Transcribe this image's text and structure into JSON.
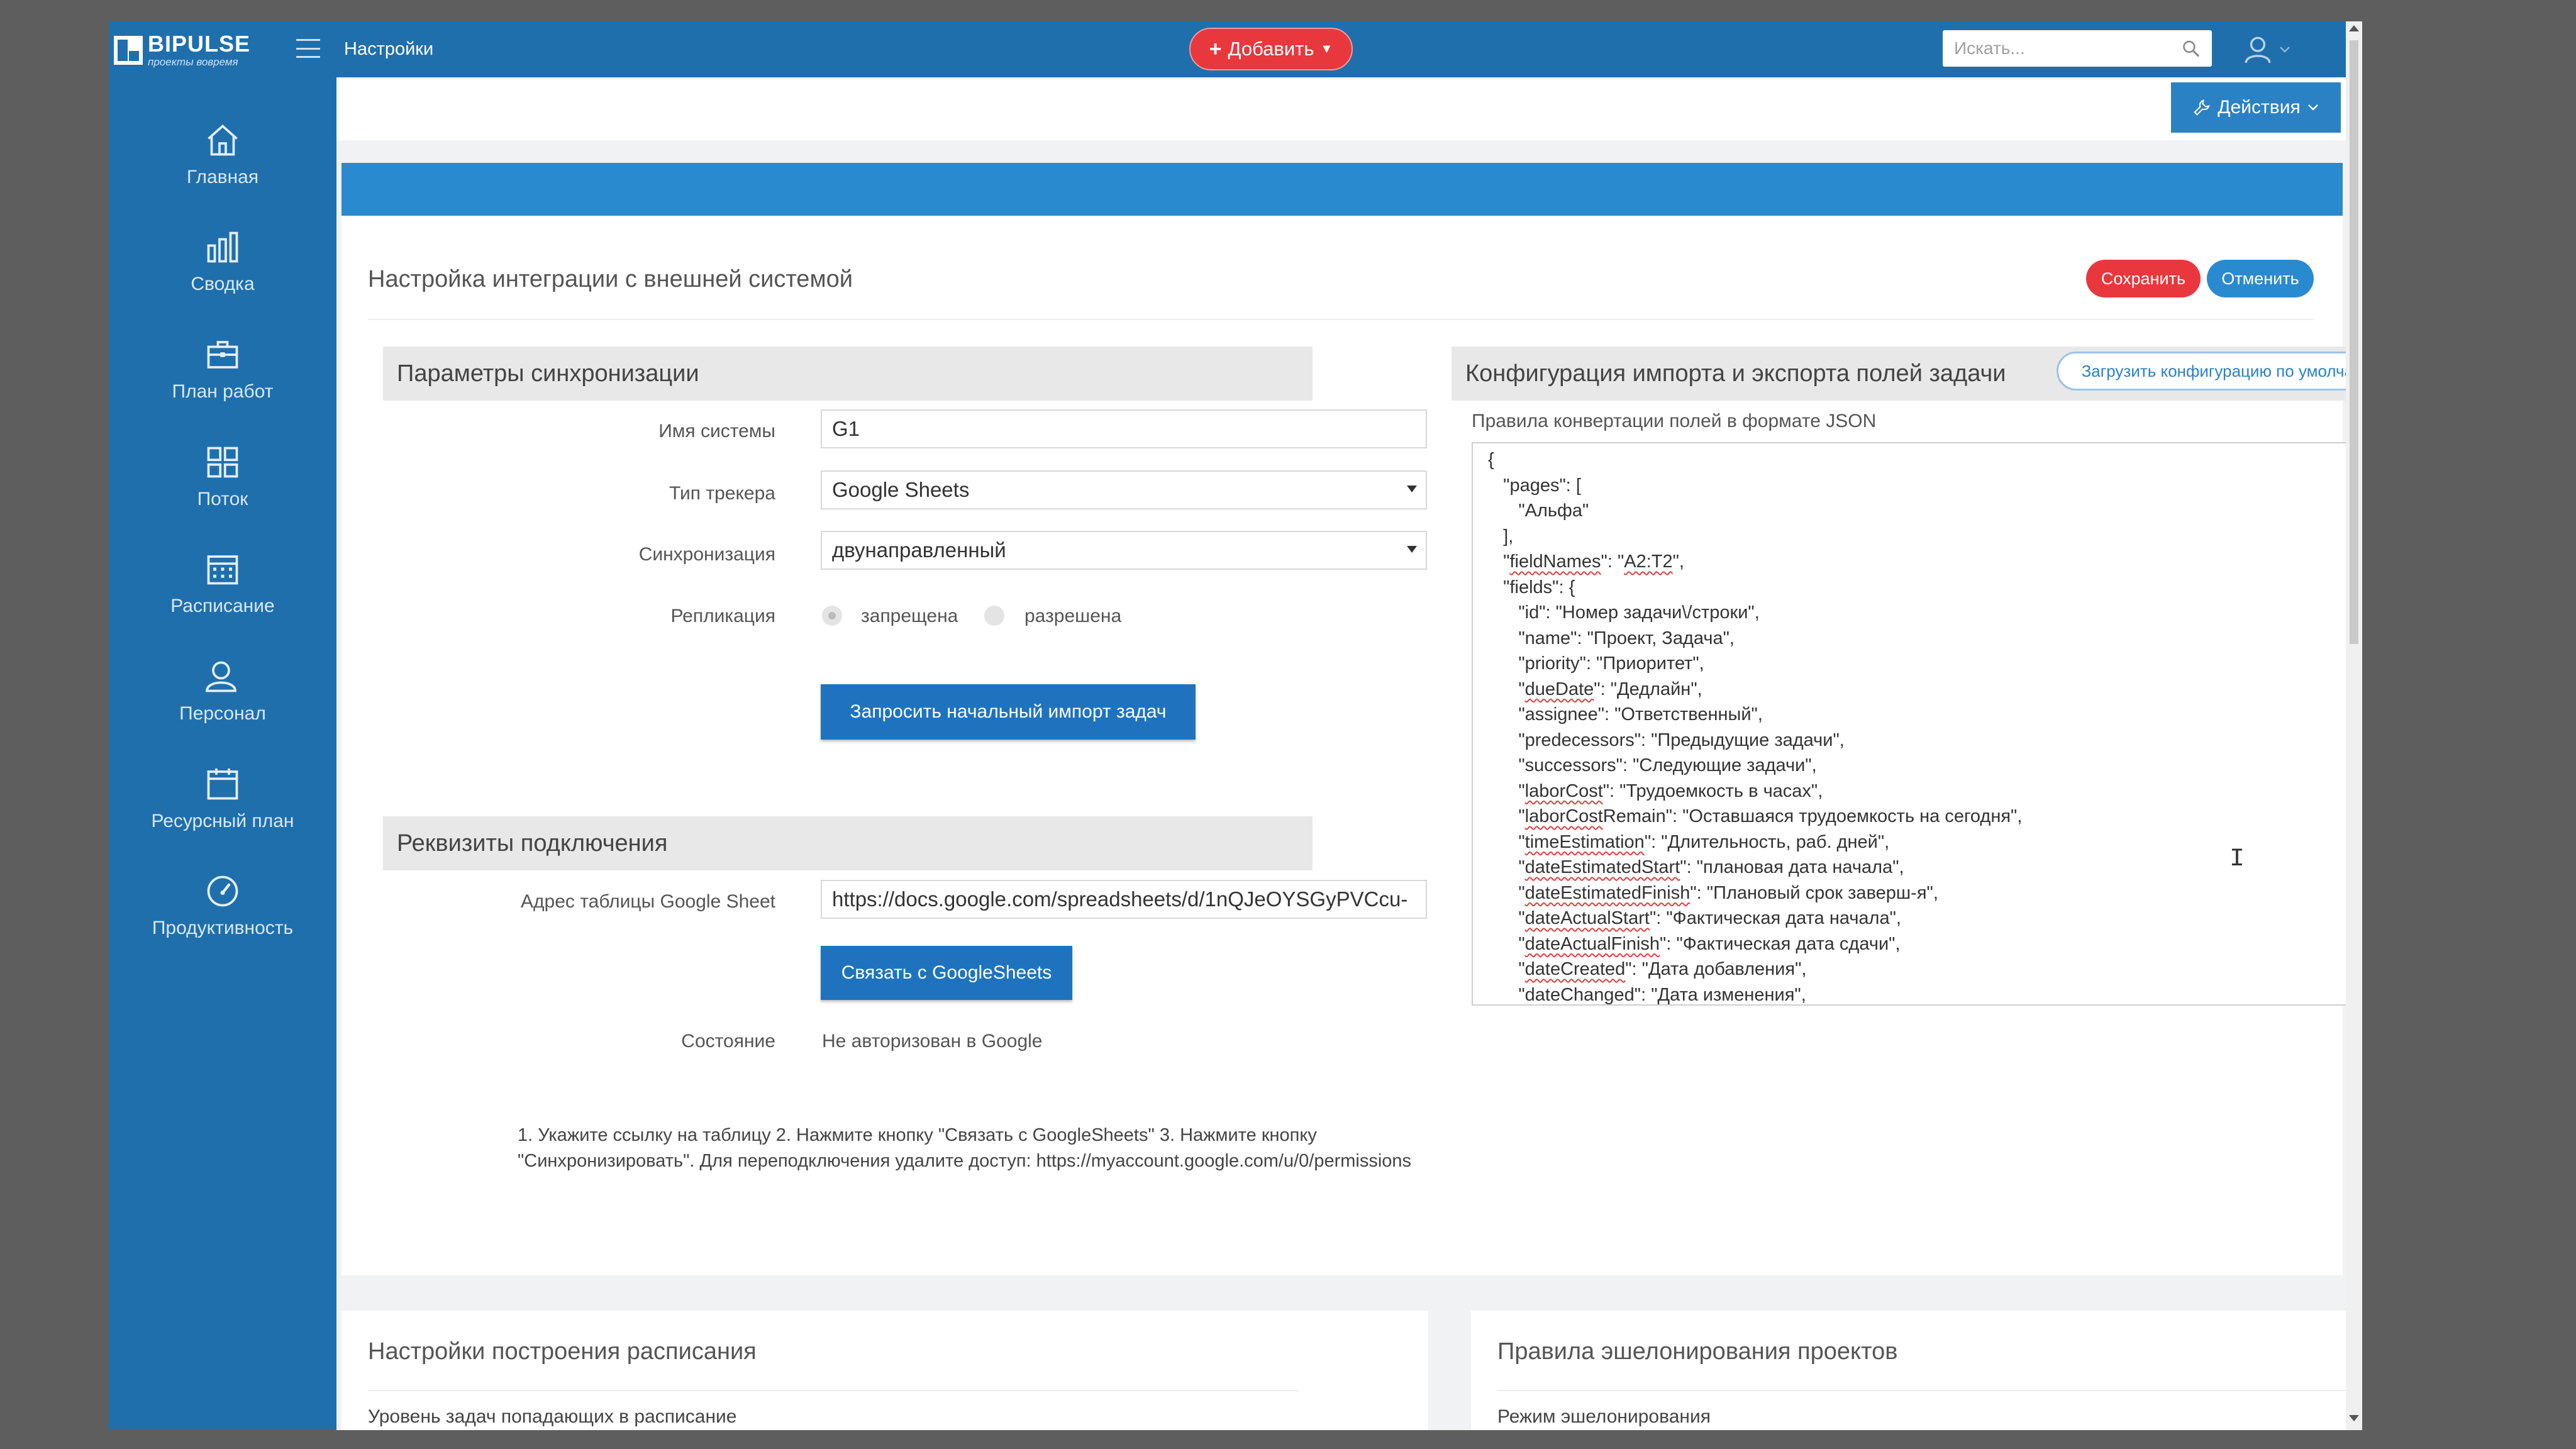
{
  "app": {
    "logo_name": "BIPULSE",
    "logo_tagline": "проекты вовремя",
    "page_title": "Настройки"
  },
  "topbar": {
    "add_label": "Добавить",
    "search_placeholder": "Искать..."
  },
  "sidebar": {
    "items": [
      {
        "label": "Главная",
        "icon": "home-icon"
      },
      {
        "label": "Сводка",
        "icon": "bar-chart-icon"
      },
      {
        "label": "План работ",
        "icon": "briefcase-icon"
      },
      {
        "label": "Поток",
        "icon": "grid-icon"
      },
      {
        "label": "Расписание",
        "icon": "calendar-icon"
      },
      {
        "label": "Персонал",
        "icon": "person-icon"
      },
      {
        "label": "Ресурсный план",
        "icon": "resource-calendar-icon"
      },
      {
        "label": "Продуктивность",
        "icon": "gauge-icon"
      }
    ]
  },
  "actions": {
    "label": "Действия"
  },
  "main": {
    "title": "Настройка интеграции с внешней системой",
    "save_label": "Сохранить",
    "cancel_label": "Отменить",
    "sync": {
      "heading": "Параметры синхронизации",
      "system_name_label": "Имя системы",
      "system_name_value": "G1",
      "tracker_type_label": "Тип трекера",
      "tracker_type_value": "Google Sheets",
      "sync_label": "Синхронизация",
      "sync_value": "двунаправленный",
      "replication_label": "Репликация",
      "replication_options": [
        "запрещена",
        "разрешена"
      ],
      "replication_selected": "запрещена",
      "import_button": "Запросить начальный импорт задач"
    },
    "connection": {
      "heading": "Реквизиты подключения",
      "sheet_url_label": "Адрес таблицы Google Sheet",
      "sheet_url_value": "https://docs.google.com/spreadsheets/d/1nQJeOYSGyPVCcu-",
      "connect_button": "Связать с GoogleSheets",
      "status_label": "Состояние",
      "status_value": "Не авторизован в Google",
      "help_text": "1. Укажите ссылку на таблицу 2. Нажмите кнопку \"Связать с GoogleSheets\" 3. Нажмите кнопку \"Синхронизировать\". Для переподключения удалите доступ: https://myaccount.google.com/u/0/permissions"
    },
    "config": {
      "heading": "Конфигурация импорта и экспорта полей задачи",
      "default_button": "Загрузить конфигурацию по умолчанию",
      "json_label": "Правила конвертации полей в формате JSON",
      "json_lines": [
        "{",
        "   \"pages\": [",
        "      \"Альфа\"",
        "   ],",
        "   \"fieldNames\": \"A2:T2\",",
        "   \"fields\": {",
        "      \"id\": \"Номер задачи\\/строки\",",
        "      \"name\": \"Проект, Задача\",",
        "      \"priority\": \"Приоритет\",",
        "      \"dueDate\": \"Дедлайн\",",
        "      \"assignee\": \"Ответственный\",",
        "      \"predecessors\": \"Предыдущие задачи\",",
        "      \"successors\": \"Следующие задачи\",",
        "      \"laborCost\": \"Трудоемкость в часах\",",
        "      \"laborCostRemain\": \"Оставшаяся трудоемкость на сегодня\",",
        "      \"timeEstimation\": \"Длительность, раб. дней\",",
        "      \"dateEstimatedStart\": \"плановая дата начала\",",
        "      \"dateEstimatedFinish\": \"Плановый срок заверш-я\",",
        "      \"dateActualStart\": \"Фактическая дата начала\",",
        "      \"dateActualFinish\": \"Фактическая дата сдачи\",",
        "      \"dateCreated\": \"Дата добавления\",",
        "      \"dateChanged\": \"Дата изменения\","
      ]
    }
  },
  "bottom": {
    "schedule_title": "Настройки построения расписания",
    "schedule_sub": "Уровень задач попадающих в расписание",
    "leveling_title": "Правила эшелонирования проектов",
    "leveling_sub": "Режим эшелонирования"
  },
  "colors": {
    "brand_blue": "#1f6fad",
    "accent_red": "#e8383d",
    "button_blue": "#2a8ad0"
  }
}
